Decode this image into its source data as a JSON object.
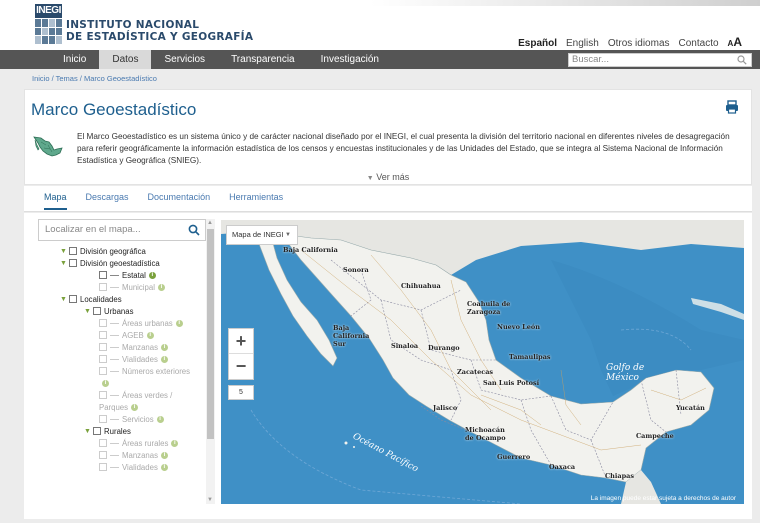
{
  "header": {
    "logo_mark": "INEGI",
    "org_line1": "INSTITUTO NACIONAL",
    "org_line2": "DE ESTADÍSTICA Y GEOGRAFÍA",
    "links": [
      "Español",
      "English",
      "Otros idiomas",
      "Contacto"
    ],
    "font_size_label": "A"
  },
  "nav": {
    "items": [
      "Inicio",
      "Datos",
      "Servicios",
      "Transparencia",
      "Investigación"
    ],
    "active": "Datos",
    "search_placeholder": "Buscar..."
  },
  "breadcrumb": "Inicio / Temas / Marco Geoestadístico",
  "page": {
    "title": "Marco Geoestadístico",
    "description": "El Marco Geoestadístico es un sistema único y de carácter nacional diseñado por el INEGI, el cual presenta la división del territorio nacional en diferentes niveles de desagregación para referir geográficamente la información estadística de los censos y encuestas institucionales y de las Unidades del Estado, que se integra al Sistema Nacional de Información Estadística y Geográfica (SNIEG).",
    "ver_mas": "Ver más"
  },
  "tabs": [
    "Mapa",
    "Descargas",
    "Documentación",
    "Herramientas"
  ],
  "layers": {
    "search_placeholder": "Localizar en el mapa...",
    "tree": [
      {
        "label": "División geográfica",
        "level": 0,
        "arrow": true
      },
      {
        "label": "División geoestadística",
        "level": 0,
        "arrow": true
      },
      {
        "label": "Estatal",
        "level": 2,
        "sym": true,
        "info": true
      },
      {
        "label": "Municipal",
        "level": 2,
        "sym": true,
        "info": true,
        "dim": true
      },
      {
        "label": "Localidades",
        "level": 0,
        "arrow": true
      },
      {
        "label": "Urbanas",
        "level": 1,
        "arrow": true
      },
      {
        "label": "Áreas urbanas",
        "level": 3,
        "sym": true,
        "info": true,
        "dim": true
      },
      {
        "label": "AGEB",
        "level": 3,
        "sym": true,
        "info": true,
        "dim": true
      },
      {
        "label": "Manzanas",
        "level": 3,
        "sym": true,
        "info": true,
        "dim": true
      },
      {
        "label": "Vialidades",
        "level": 3,
        "sym": true,
        "info": true,
        "dim": true
      },
      {
        "label": "Números exteriores",
        "level": 3,
        "sym": true,
        "dim": true
      },
      {
        "label": "",
        "level": 3,
        "info": true,
        "dim": true,
        "bare": true
      },
      {
        "label": "Áreas verdes /",
        "level": 3,
        "sym": true,
        "dim": true
      },
      {
        "label": "Parques",
        "level": 3,
        "info": true,
        "dim": true,
        "bare": true
      },
      {
        "label": "Servicios",
        "level": 3,
        "sym": true,
        "info": true,
        "dim": true
      },
      {
        "label": "Rurales",
        "level": 1,
        "arrow": true
      },
      {
        "label": "Áreas rurales",
        "level": 3,
        "sym": true,
        "info": true,
        "dim": true
      },
      {
        "label": "Manzanas",
        "level": 3,
        "sym": true,
        "info": true,
        "dim": true
      },
      {
        "label": "Vialidades",
        "level": 3,
        "sym": true,
        "info": true,
        "dim": true
      }
    ]
  },
  "map": {
    "type_label": "Mapa de INEGI",
    "zoom_in": "+",
    "zoom_out": "−",
    "zoom_level": "5",
    "attribution": "La imagen puede estar sujeta a derechos de autor",
    "labels": {
      "baja_california": "Baja California",
      "sonora": "Sonora",
      "chihuahua": "Chihuahua",
      "coahuila": "Coahuila de Zaragoza",
      "nuevo_leon": "Nuevo León",
      "baja_california_sur": "Baja California Sur",
      "sinaloa": "Sinaloa",
      "durango": "Durango",
      "tamaulipas": "Tamaulipas",
      "zacatecas": "Zacatecas",
      "san_luis": "San Luis Potosí",
      "jalisco": "Jalisco",
      "michoacan": "Michoacán de Ocampo",
      "guerrero": "Guerrero",
      "oaxaca": "Oaxaca",
      "chiapas": "Chiapas",
      "yucatan": "Yucatán",
      "campeche": "Campeche",
      "golfo": "Golfo de México",
      "pacifico": "Océano Pacífico"
    }
  },
  "colors": {
    "nav_bg": "#555555",
    "title_blue": "#1e5f8e",
    "link_blue": "#4a7ab0",
    "accent_green": "#7aa13c",
    "ocean": "#3f90c6",
    "land": "#f2f2ee"
  }
}
